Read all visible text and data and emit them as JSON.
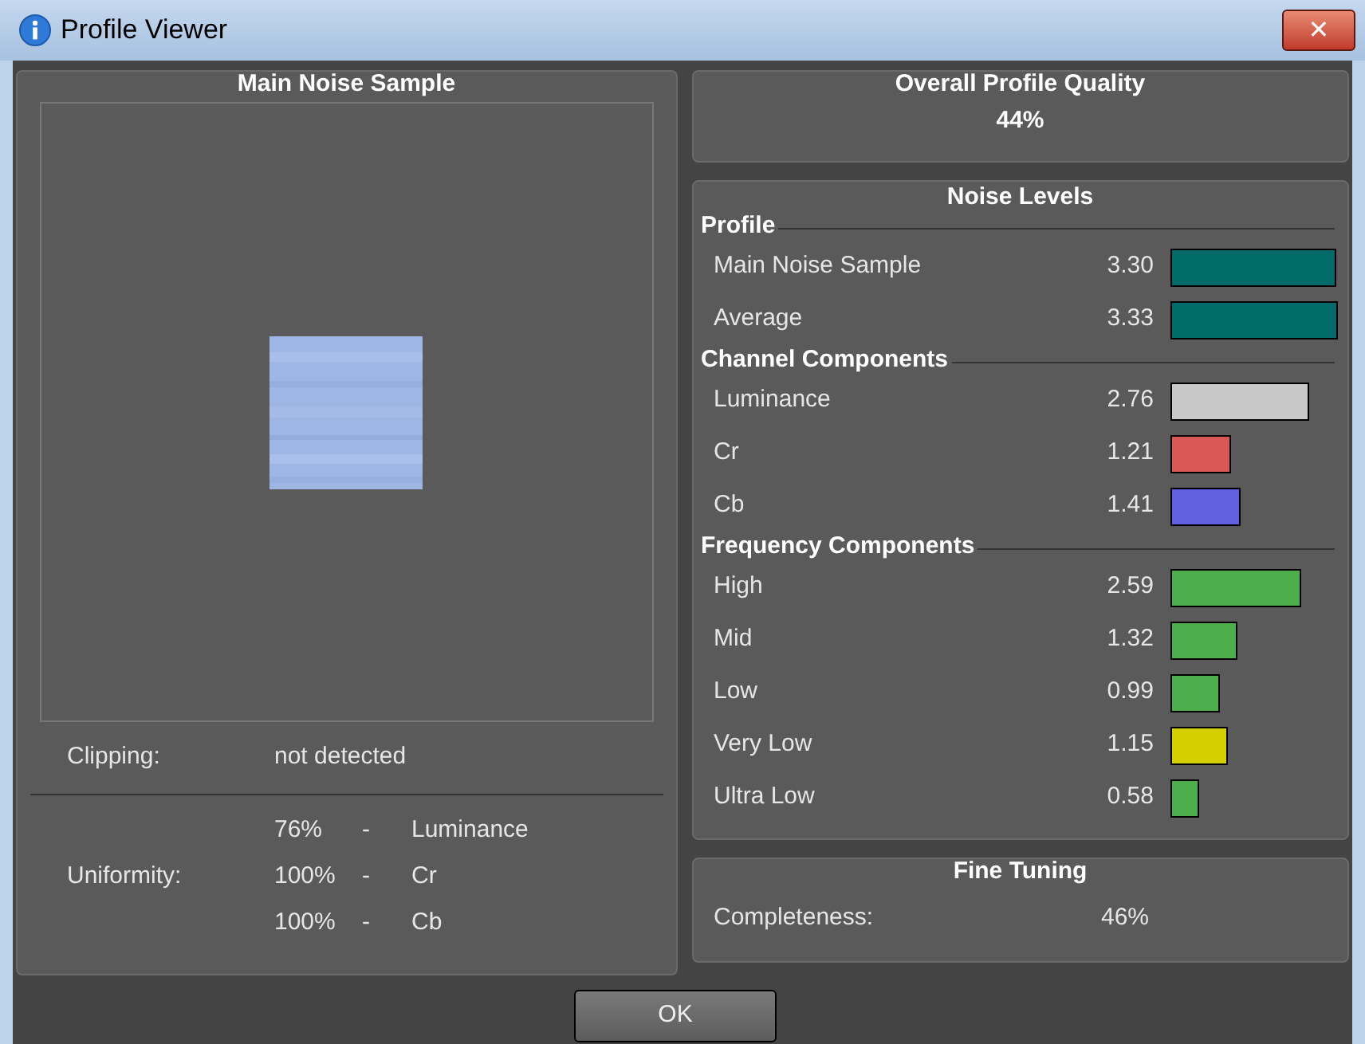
{
  "window": {
    "title": "Profile Viewer",
    "close_glyph": "✕"
  },
  "main_noise_sample": {
    "title": "Main Noise Sample",
    "clipping": {
      "label": "Clipping:",
      "value": "not detected"
    },
    "uniformity": {
      "label": "Uniformity:",
      "rows": [
        {
          "percent": "76%",
          "dash": "-",
          "channel": "Luminance"
        },
        {
          "percent": "100%",
          "dash": "-",
          "channel": "Cr"
        },
        {
          "percent": "100%",
          "dash": "-",
          "channel": "Cb"
        }
      ]
    }
  },
  "overall_profile_quality": {
    "title": "Overall Profile Quality",
    "value": "44%"
  },
  "noise_levels": {
    "title": "Noise Levels",
    "groups": [
      {
        "title": "Profile",
        "items": [
          {
            "name": "Main Noise Sample",
            "value": "3.30",
            "color": "#006b68"
          },
          {
            "name": "Average",
            "value": "3.33",
            "color": "#006b68"
          }
        ]
      },
      {
        "title": "Channel Components",
        "items": [
          {
            "name": "Luminance",
            "value": "2.76",
            "color": "#c8c8c8"
          },
          {
            "name": "Cr",
            "value": "1.21",
            "color": "#d95757"
          },
          {
            "name": "Cb",
            "value": "1.41",
            "color": "#6060e0"
          }
        ]
      },
      {
        "title": "Frequency Components",
        "items": [
          {
            "name": "High",
            "value": "2.59",
            "color": "#4caf4c"
          },
          {
            "name": "Mid",
            "value": "1.32",
            "color": "#4caf4c"
          },
          {
            "name": "Low",
            "value": "0.99",
            "color": "#4caf4c"
          },
          {
            "name": "Very Low",
            "value": "1.15",
            "color": "#d4d000"
          },
          {
            "name": "Ultra Low",
            "value": "0.58",
            "color": "#4caf4c"
          }
        ]
      }
    ]
  },
  "fine_tuning": {
    "title": "Fine Tuning",
    "label": "Completeness:",
    "value": "46%"
  },
  "buttons": [
    {
      "label": "OK"
    }
  ]
}
